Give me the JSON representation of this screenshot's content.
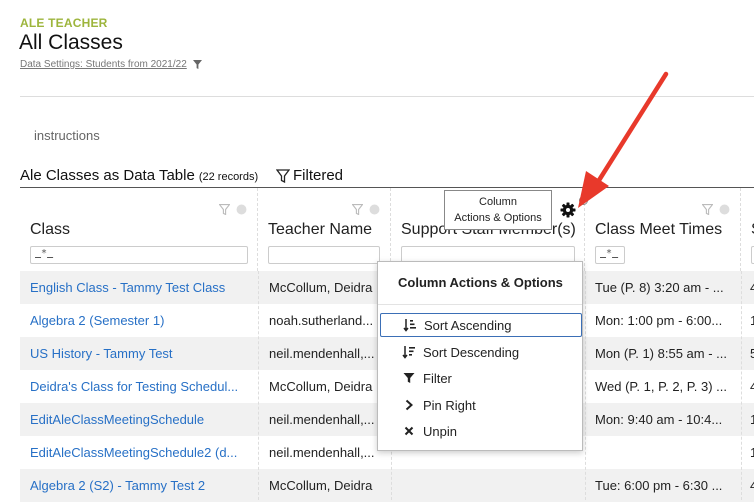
{
  "header": {
    "app_label": "ALE TEACHER",
    "title": "All Classes",
    "data_settings": "Data Settings: Students from 2021/22"
  },
  "instructions": "instructions",
  "table": {
    "title": "Ale Classes as Data Table",
    "record_count": "(22 records)",
    "filtered_label": "Filtered",
    "columns": [
      {
        "label": "Class",
        "filter_placeholder": "*"
      },
      {
        "label": "Teacher Name",
        "filter_placeholder": ""
      },
      {
        "label": "Support Staff Member(s)",
        "filter_placeholder": ""
      },
      {
        "label": "Class Meet Times",
        "filter_placeholder": "*"
      },
      {
        "label": "S",
        "filter_placeholder": ""
      }
    ],
    "rows": [
      {
        "class": "English Class - Tammy Test Class",
        "teacher": "McCollum, Deidra",
        "meet": "Tue (P. 8) 3:20 am - ...",
        "extra": "4"
      },
      {
        "class": "Algebra 2 (Semester 1)",
        "teacher": "noah.sutherland...",
        "meet": "Mon: 1:00 pm - 6:00...",
        "extra": "1"
      },
      {
        "class": "US History - Tammy Test",
        "teacher": "neil.mendenhall,...",
        "meet": "Mon (P. 1) 8:55 am - ...",
        "extra": "5"
      },
      {
        "class": "Deidra's Class for Testing Schedul...",
        "teacher": "McCollum, Deidra",
        "meet": "Wed (P. 1, P. 2, P. 3) ...",
        "extra": "4"
      },
      {
        "class": "EditAleClassMeetingSchedule",
        "teacher": "neil.mendenhall,...",
        "meet": "Mon: 9:40 am - 10:4...",
        "extra": "1"
      },
      {
        "class": "EditAleClassMeetingSchedule2 (d...",
        "teacher": "neil.mendenhall,...",
        "meet": "",
        "extra": "1"
      },
      {
        "class": "Algebra 2 (S2) - Tammy Test 2",
        "teacher": "McCollum, Deidra",
        "meet": "Tue: 6:00 pm - 6:30 ...",
        "extra": "4"
      }
    ]
  },
  "tooltip": "Column Actions & Options",
  "column_menu": {
    "title": "Column Actions & Options",
    "items": [
      {
        "label": "Sort Ascending",
        "icon": "sort-ascending-icon",
        "selected": true
      },
      {
        "label": "Sort Descending",
        "icon": "sort-descending-icon",
        "selected": false
      },
      {
        "label": "Filter",
        "icon": "filter-icon",
        "selected": false
      },
      {
        "label": "Pin Right",
        "icon": "chevron-right-icon",
        "selected": false
      },
      {
        "label": "Unpin",
        "icon": "close-icon",
        "selected": false
      }
    ]
  },
  "colors": {
    "app_label": "#9db53c",
    "link": "#2770c6",
    "annotation_arrow": "#e8392b",
    "selected_outline": "#3b6fb6"
  }
}
